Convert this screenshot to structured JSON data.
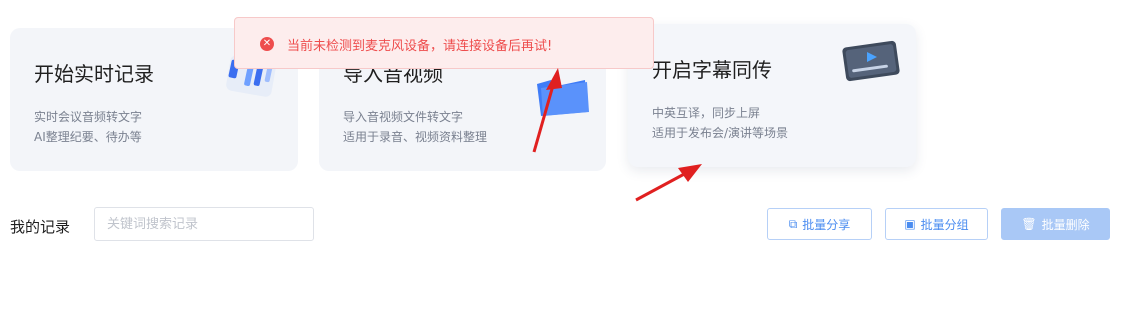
{
  "cards": [
    {
      "title": "开始实时记录",
      "desc1": "实时会议音频转文字",
      "desc2": "AI整理纪要、待办等"
    },
    {
      "title": "导入音视频",
      "desc1": "导入音视频文件转文字",
      "desc2": "适用于录音、视频资料整理"
    },
    {
      "title": "开启字幕同传",
      "desc1": "中英互译，同步上屏",
      "desc2": "适用于发布会/演讲等场景"
    }
  ],
  "toast": {
    "message": "当前未检测到麦克风设备，请连接设备后再试!",
    "icon": "error-icon"
  },
  "records": {
    "label": "我的记录",
    "search_placeholder": "关键词搜索记录",
    "share_label": "批量分享",
    "group_label": "批量分组",
    "delete_label": "批量删除"
  },
  "colors": {
    "accent": "#4a8cf0",
    "error": "#ee4d4d",
    "card_bg": "#f3f5f9",
    "arrow": "#e02020"
  }
}
